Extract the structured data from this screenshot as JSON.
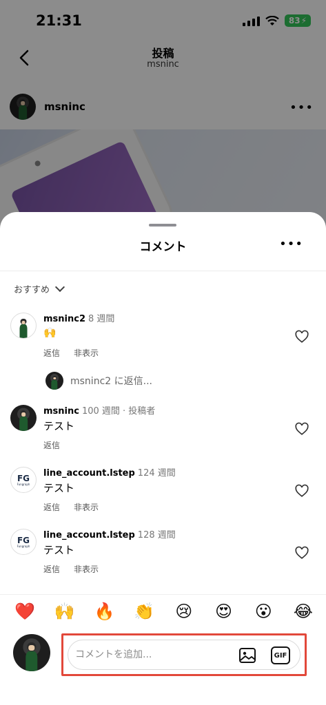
{
  "status_bar": {
    "time": "21:31",
    "battery": "83"
  },
  "post": {
    "title": "投稿",
    "subtitle": "msninc",
    "username": "msninc"
  },
  "sheet": {
    "title": "コメント",
    "sort_label": "おすすめ"
  },
  "comments": [
    {
      "username": "msninc2",
      "meta": "8 週間",
      "text": "🙌",
      "actions": [
        "返信",
        "非表示"
      ]
    },
    {
      "username": "msninc",
      "meta": "100 週間 · 投稿者",
      "text": "テスト",
      "actions": [
        "返信"
      ]
    },
    {
      "username": "line_account.lstep",
      "meta": "124 週間",
      "text": "テスト",
      "actions": [
        "返信",
        "非表示"
      ]
    },
    {
      "username": "line_account.lstep",
      "meta": "128 週間",
      "text": "テスト",
      "actions": [
        "返信",
        "非表示"
      ]
    }
  ],
  "reply_prompt": "msninc2 に返信...",
  "emojis": [
    "❤️",
    "🙌",
    "🔥",
    "👏",
    "😢",
    "😍",
    "😮",
    "😂"
  ],
  "compose": {
    "placeholder": "コメントを追加...",
    "gif_label": "GIF"
  },
  "colors": {
    "highlight_border": "#e2483a",
    "battery_green": "#34c759"
  }
}
